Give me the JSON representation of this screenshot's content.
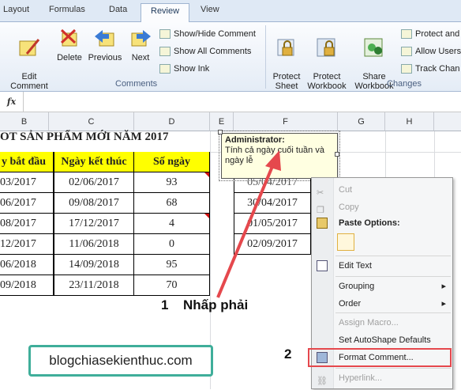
{
  "ribbon_tabs": [
    "Layout",
    "Formulas",
    "Data",
    "Review",
    "View"
  ],
  "ribbon": {
    "edit_comment": "Edit\nComment",
    "delete": "Delete",
    "previous": "Previous",
    "next": "Next",
    "show_hide_comment": "Show/Hide Comment",
    "show_all_comments": "Show All Comments",
    "show_ink": "Show Ink",
    "comments_group": "Comments",
    "protect_sheet": "Protect\nSheet",
    "protect_workbook": "Protect\nWorkbook",
    "share_workbook": "Share\nWorkbook",
    "protect_and": "Protect and",
    "allow_users": "Allow Users",
    "track_changes": "Track Chan",
    "changes_group": "Changes"
  },
  "formula_bar": {
    "fx": "fx"
  },
  "columns": [
    "B",
    "C",
    "D",
    "E",
    "F",
    "G",
    "H"
  ],
  "sheet": {
    "title": "OT SẢN PHẨM MỚI NĂM 2017",
    "headers": [
      "y bắt đầu",
      "Ngày kết thúc",
      "Số ngày"
    ],
    "rows": [
      [
        "03/2017",
        "02/06/2017",
        "93"
      ],
      [
        "06/2017",
        "09/08/2017",
        "68"
      ],
      [
        "08/2017",
        "17/12/2017",
        "4"
      ],
      [
        "12/2017",
        "11/06/2018",
        "0"
      ],
      [
        "06/2018",
        "14/09/2018",
        "95"
      ],
      [
        "09/2018",
        "23/11/2018",
        "70"
      ]
    ],
    "f_values": [
      "30/04/2017",
      "01/05/2017",
      "02/09/2017"
    ],
    "f_partial": "05/04/2017"
  },
  "comment": {
    "author": "Administrator:",
    "text": "Tính cả ngày cuối tuần và ngày lễ"
  },
  "context_menu": {
    "cut": "Cut",
    "copy": "Copy",
    "paste_options": "Paste Options:",
    "edit_text": "Edit Text",
    "grouping": "Grouping",
    "order": "Order",
    "assign_macro": "Assign Macro...",
    "set_autoshape": "Set AutoShape Defaults",
    "format_comment": "Format Comment...",
    "hyperlink": "Hyperlink..."
  },
  "annotations": {
    "step1_num": "1",
    "step1_text": "Nhấp phải",
    "step2_num": "2"
  },
  "watermark": "blogchiasekienthuc.com",
  "colors": {
    "accent_red": "#e5484d",
    "header_yellow": "#ffff00",
    "watermark_border": "#3fae9a"
  }
}
